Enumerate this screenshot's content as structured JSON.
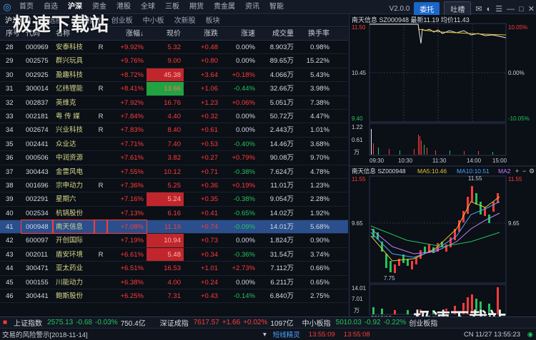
{
  "app": {
    "menu": [
      "首页",
      "自选",
      "沪深",
      "资金",
      "港股",
      "全球",
      "三板",
      "期货",
      "贵金属",
      "资讯",
      "智能"
    ],
    "active_menu": "沪深",
    "version": "V2.0.0",
    "btn_weituo": "委托",
    "btn_tuzao": "吐槽",
    "watermark": "极速下载站"
  },
  "subtabs": [
    "沪深A股",
    "自选股",
    "沪深指数",
    "创业板",
    "中小板",
    "次新股",
    "板块"
  ],
  "subtabs_visible": [
    "沪深",
    "",
    "板块",
    "沪深指数",
    "创业板",
    "中小板",
    "次新股",
    "板块"
  ],
  "table": {
    "headers": [
      "序号",
      "代码",
      "名称",
      "",
      "涨幅↓",
      "现价",
      "涨跌",
      "涨速",
      "成交量",
      "换手率"
    ],
    "rows": [
      {
        "no": "28",
        "code": "000969",
        "name": "安泰科技",
        "r": "R",
        "pct": "+9.92%",
        "price": "5.32",
        "chg": "+0.48",
        "speed": "0.00%",
        "vol": "8.903万",
        "turn": "0.98%"
      },
      {
        "no": "29",
        "code": "002575",
        "name": "群兴玩具",
        "r": "",
        "pct": "+9.76%",
        "price": "9.00",
        "chg": "+0.80",
        "speed": "0.00%",
        "vol": "89.65万",
        "turn": "15.22%"
      },
      {
        "no": "30",
        "code": "002925",
        "name": "盈趣科技",
        "r": "",
        "pct": "+8.72%",
        "price": "45.38",
        "chg": "+3.64",
        "speed": "+0.18%",
        "vol": "4.066万",
        "turn": "5.43%"
      },
      {
        "no": "31",
        "code": "300014",
        "name": "亿纬锂能",
        "r": "R",
        "pct": "+8.41%",
        "price": "13.66",
        "chg": "+1.06",
        "speed": "-0.44%",
        "vol": "32.66万",
        "turn": "3.98%"
      },
      {
        "no": "32",
        "code": "002837",
        "name": "英维克",
        "r": "",
        "pct": "+7.92%",
        "price": "16.76",
        "chg": "+1.23",
        "speed": "+0.06%",
        "vol": "5.051万",
        "turn": "7.38%"
      },
      {
        "no": "33",
        "code": "002181",
        "name": "粤 传 媒",
        "r": "R",
        "pct": "+7.84%",
        "price": "4.40",
        "chg": "+0.32",
        "speed": "0.00%",
        "vol": "50.72万",
        "turn": "4.47%"
      },
      {
        "no": "34",
        "code": "002674",
        "name": "兴业科技",
        "r": "R",
        "pct": "+7.83%",
        "price": "8.40",
        "chg": "+0.61",
        "speed": "0.00%",
        "vol": "2.443万",
        "turn": "1.01%"
      },
      {
        "no": "35",
        "code": "002441",
        "name": "众业达",
        "r": "",
        "pct": "+7.71%",
        "price": "7.40",
        "chg": "+0.53",
        "speed": "-0.40%",
        "vol": "14.46万",
        "turn": "3.68%"
      },
      {
        "no": "36",
        "code": "000506",
        "name": "中润资源",
        "r": "",
        "pct": "+7.61%",
        "price": "3.82",
        "chg": "+0.27",
        "speed": "+0.79%",
        "vol": "90.08万",
        "turn": "9.70%"
      },
      {
        "no": "37",
        "code": "300443",
        "name": "金雷风电",
        "r": "",
        "pct": "+7.55%",
        "price": "10.12",
        "chg": "+0.71",
        "speed": "-0.38%",
        "vol": "7.624万",
        "turn": "4.78%"
      },
      {
        "no": "38",
        "code": "001696",
        "name": "宗申动力",
        "r": "R",
        "pct": "+7.36%",
        "price": "5.25",
        "chg": "+0.36",
        "speed": "+0.19%",
        "vol": "11.01万",
        "turn": "1.23%"
      },
      {
        "no": "39",
        "code": "002291",
        "name": "星期六",
        "r": "",
        "pct": "+7.16%",
        "price": "5.24",
        "chg": "+0.35",
        "speed": "-0.38%",
        "vol": "9.054万",
        "turn": "2.28%"
      },
      {
        "no": "40",
        "code": "002534",
        "name": "杭锅股份",
        "r": "",
        "pct": "+7.13%",
        "price": "6.16",
        "chg": "+0.41",
        "speed": "-0.65%",
        "vol": "14.02万",
        "turn": "1.92%"
      },
      {
        "no": "41",
        "code": "000948",
        "name": "南天信息",
        "r": "",
        "pct": "+7.08%",
        "price": "11.19",
        "chg": "+0.74",
        "speed": "-0.09%",
        "vol": "14.01万",
        "turn": "5.68%"
      },
      {
        "no": "42",
        "code": "600097",
        "name": "开创国际",
        "r": "",
        "pct": "+7.19%",
        "price": "10.94",
        "chg": "+0.73",
        "speed": "0.00%",
        "vol": "1.824万",
        "turn": "0.90%"
      },
      {
        "no": "43",
        "code": "002011",
        "name": "盾安环境",
        "r": "R",
        "pct": "+6.61%",
        "price": "5.48",
        "chg": "+0.34",
        "speed": "-0.36%",
        "vol": "31.54万",
        "turn": "3.74%"
      },
      {
        "no": "44",
        "code": "300471",
        "name": "亚太药业",
        "r": "",
        "pct": "+6.51%",
        "price": "16.53",
        "chg": "+1.01",
        "speed": "+2.73%",
        "vol": "7.112万",
        "turn": "0.66%"
      },
      {
        "no": "45",
        "code": "000155",
        "name": "川能动力",
        "r": "",
        "pct": "+6.38%",
        "price": "4.00",
        "chg": "+0.24",
        "speed": "0.00%",
        "vol": "6.211万",
        "turn": "0.65%"
      },
      {
        "no": "46",
        "code": "300441",
        "name": "鲍斯股份",
        "r": "",
        "pct": "+6.25%",
        "price": "7.31",
        "chg": "+0.43",
        "speed": "-0.14%",
        "vol": "6.840万",
        "turn": "2.75%"
      }
    ]
  },
  "chart_data": [
    {
      "type": "line",
      "title": "南天信息 SZ000948 最新11.19 均价11.43",
      "x_ticks": [
        "09:30",
        "10:30",
        "11:30",
        "14:00",
        "15:00"
      ],
      "y_left": [
        "11.50",
        "10.45",
        "9.40"
      ],
      "y_right": [
        "10.05%",
        "0.00%",
        "-10.05%"
      ],
      "volume_ticks": [
        "1.22",
        "0.61",
        "万"
      ]
    },
    {
      "type": "line",
      "title": "南天信息 SZ000948",
      "legend": [
        "MA5:10.46",
        "MA10:10.51",
        "MA2"
      ],
      "y_left": [
        "11.55",
        "9.65",
        "7.75"
      ],
      "y_right": [
        "11.55",
        "9.65"
      ],
      "annotations": [
        "11.55",
        "7.75"
      ],
      "volume_ticks": [
        "14.01",
        "7.01",
        "万"
      ],
      "x_label": "2018/10"
    }
  ],
  "bottombar": {
    "sh_name": "上证指数",
    "sh_val": "2575.13",
    "sh_chg": "-0.68",
    "sh_pct": "-0.03%",
    "sh_amt": "750.4亿",
    "sz_name": "深证成指",
    "sz_val": "7617.57",
    "sz_chg": "+1.66",
    "sz_pct": "+0.02%",
    "sz_amt": "1097亿",
    "zx_name": "中小板指",
    "zx_val": "5010.03",
    "zx_chg": "-0.92",
    "zx_pct": "-0.22%",
    "cyb_name": "创业板指"
  },
  "status": {
    "notice": "交易的风险警示[2018-11-14]",
    "jingling": "短线精灵",
    "time1": "13:55:09",
    "time2": "13:55:08",
    "clock": "CN 11/27 13:55:23"
  }
}
